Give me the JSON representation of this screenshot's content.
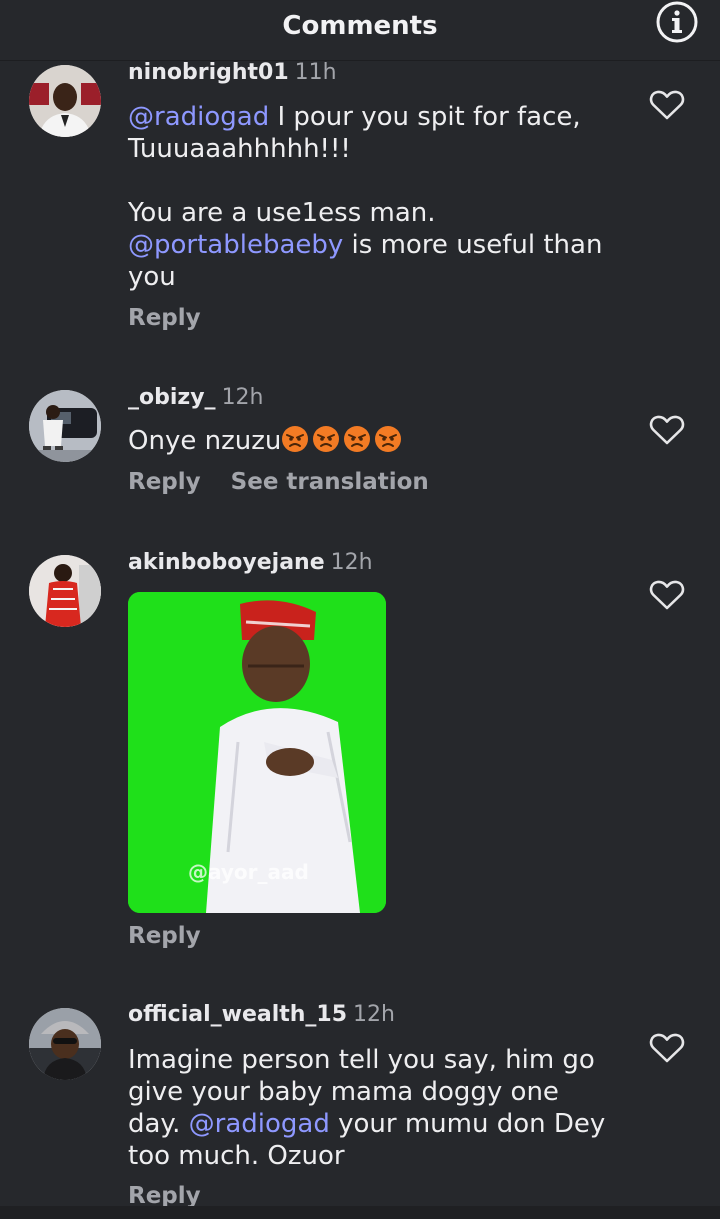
{
  "header": {
    "title": "Comments",
    "info_icon": "info-icon"
  },
  "comments": [
    {
      "username": "ninobright01",
      "time": "11h",
      "lines": [
        {
          "mention": "@radiogad",
          "text": " I pour you spit for face,"
        },
        {
          "text": "Tuuuaaahhhhh!!!"
        },
        {
          "text": ""
        },
        {
          "text": "You are a use1ess man."
        },
        {
          "mention": "@portablebaeby",
          "text": " is more useful than"
        },
        {
          "text": "you"
        }
      ],
      "reply_label": "Reply"
    },
    {
      "username": "_obizy_",
      "time": "12h",
      "text": "Onye nzuzu",
      "emoji_count": 4,
      "emoji_name": "angry-face-emoji",
      "reply_label": "Reply",
      "translate_label": "See translation"
    },
    {
      "username": "akinboboyejane",
      "time": "12h",
      "gif_watermark": "@ayor_aad",
      "reply_label": "Reply"
    },
    {
      "username": "official_wealth_15",
      "time": "12h",
      "lines": [
        {
          "text": "Imagine person tell you say, him go"
        },
        {
          "text": "give your baby mama doggy one"
        },
        {
          "prefix": "day. ",
          "mention": "@radiogad",
          "text": " your mumu don Dey"
        },
        {
          "text": "too much. Ozuor"
        }
      ],
      "reply_label": "Reply"
    }
  ],
  "colors": {
    "background": "#26282c",
    "mention": "#8e98ff",
    "muted": "#a3a5ab",
    "gif_green": "#1fe01a"
  }
}
